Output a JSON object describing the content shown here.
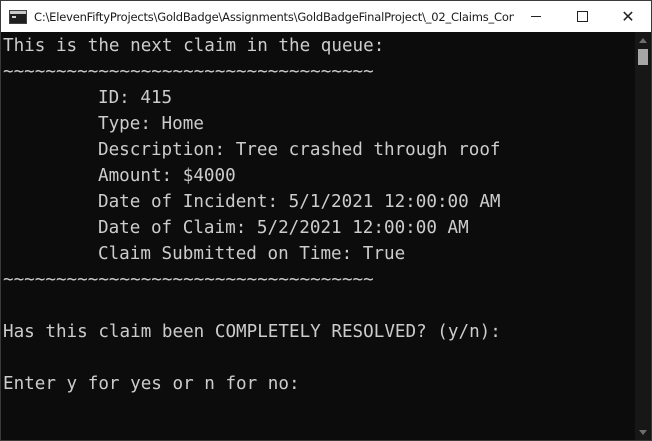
{
  "window": {
    "title": "C:\\ElevenFiftyProjects\\GoldBadge\\Assignments\\GoldBadgeFinalProject\\_02_Claims_Cons...",
    "minimize_label": "",
    "maximize_label": "",
    "close_label": "✕"
  },
  "console": {
    "header": "This is the next claim in the queue:",
    "separator": "~~~~~~~~~~~~~~~~~~~~~~~~~~~~~~~~~~~",
    "claim": {
      "id": "ID: 415",
      "type": "Type: Home",
      "description": "Description: Tree crashed through roof",
      "amount": "Amount: $4000",
      "date_of_incident": "Date of Incident: 5/1/2021 12:00:00 AM",
      "date_of_claim": "Date of Claim: 5/2/2021 12:00:00 AM",
      "submitted_on_time": "Claim Submitted on Time: True"
    },
    "prompt_resolved": "Has this claim been COMPLETELY RESOLVED? (y/n):",
    "prompt_enter": "Enter y for yes or n for no:"
  },
  "scrollbar": {
    "up_arrow_icon": "triangle-up",
    "down_arrow_icon": "triangle-down"
  },
  "colors": {
    "console_background": "#0c0c0c",
    "console_text": "#cccccc",
    "titlebar": "#ffffff"
  }
}
